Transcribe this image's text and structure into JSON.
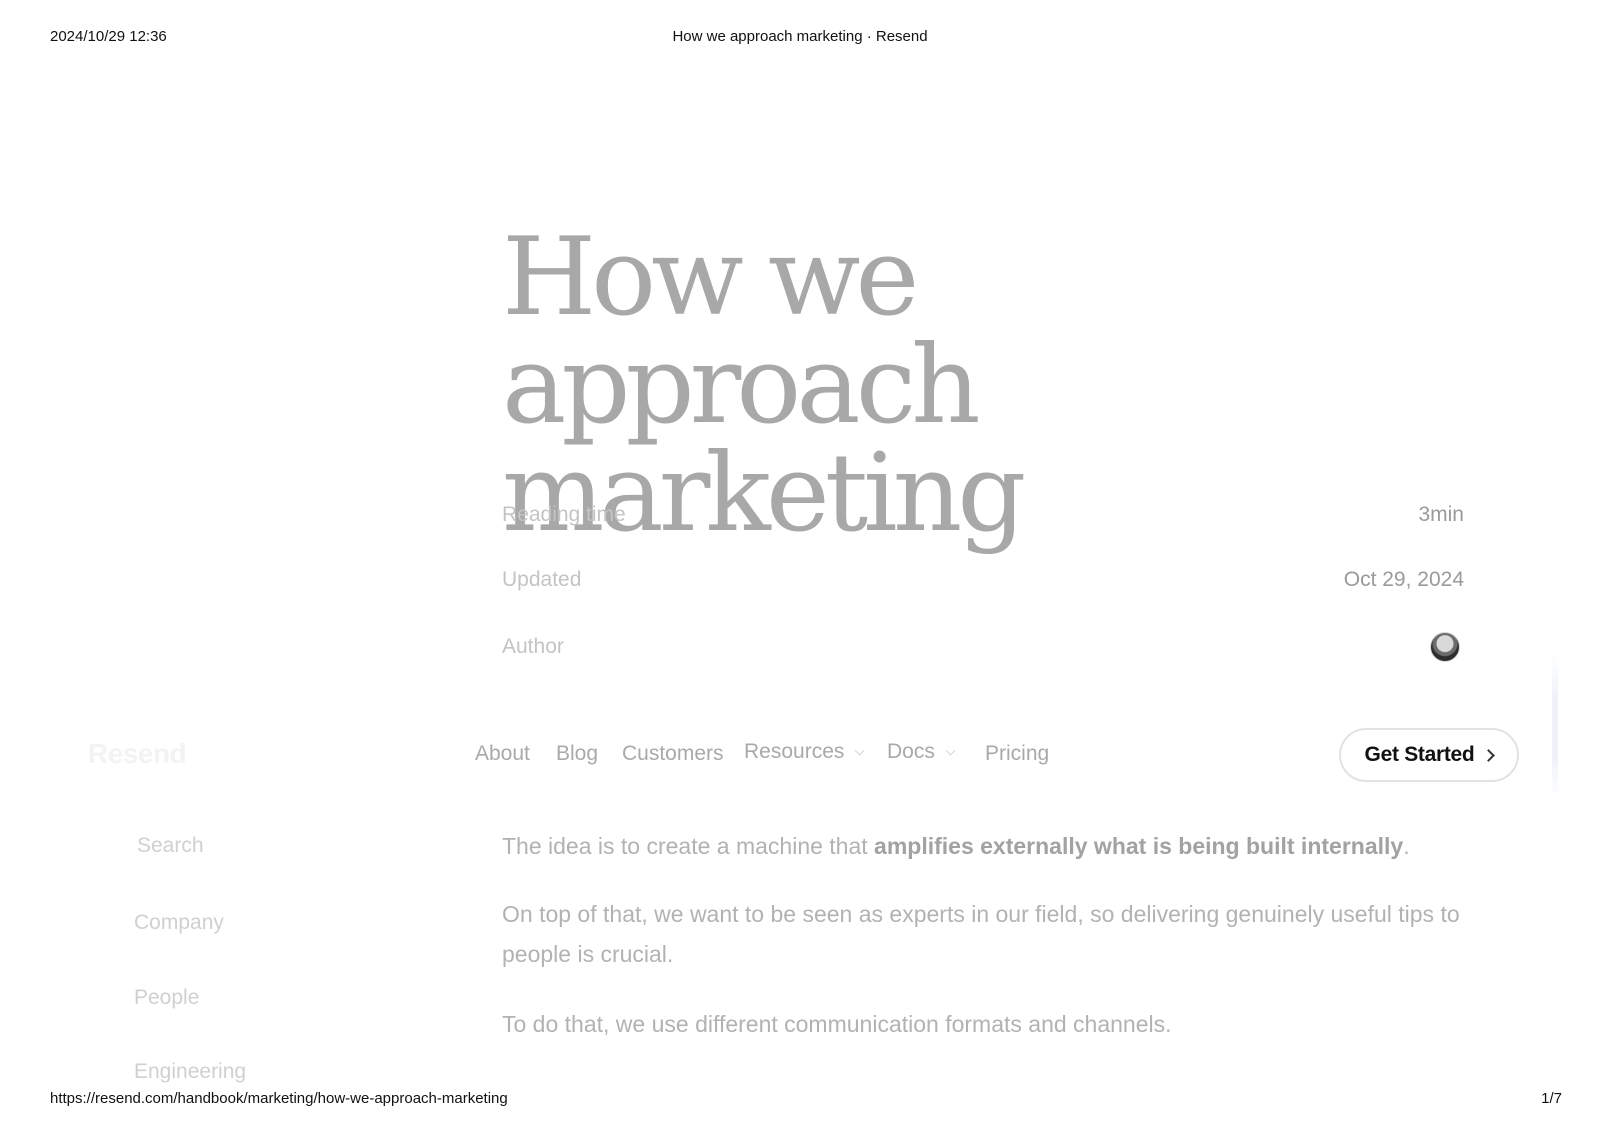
{
  "print_header": {
    "datetime": "2024/10/29 12:36",
    "title": "How we approach marketing · Resend"
  },
  "print_footer": {
    "url": "https://resend.com/handbook/marketing/how-we-approach-marketing",
    "page": "1/7"
  },
  "article": {
    "title_line1": "How we approach",
    "title_line2": "marketing",
    "meta": {
      "reading_time_label": "Reading time",
      "reading_time_value": "3min",
      "updated_label": "Updated",
      "updated_value": "Oct 29, 2024",
      "author_label": "Author",
      "author_avatar_icon": "avatar-photo"
    },
    "paragraphs": {
      "p1_text": "The idea is to create a machine that ",
      "p1_bold": "amplifies externally what is being built internally",
      "p1_end": ".",
      "p2": "On top of that, we want to be seen as experts in our field, so delivering genuinely useful tips to people is crucial.",
      "p3": "To do that, we use different communication formats and channels."
    }
  },
  "nav": {
    "logo": "Resend",
    "items": {
      "about": "About",
      "blog": "Blog",
      "customers": "Customers",
      "resources": "Resources",
      "docs": "Docs",
      "pricing": "Pricing"
    },
    "cta": "Get Started",
    "cta_icon": "chevron-right-icon",
    "dropdown_icon": "chevron-down-icon"
  },
  "sidebar": {
    "search": "Search",
    "items": [
      "Company",
      "People",
      "Engineering"
    ]
  },
  "colors": {
    "title": "#a8a8a8",
    "muted_text": "#b2b2b2",
    "cta_text": "#111111"
  }
}
